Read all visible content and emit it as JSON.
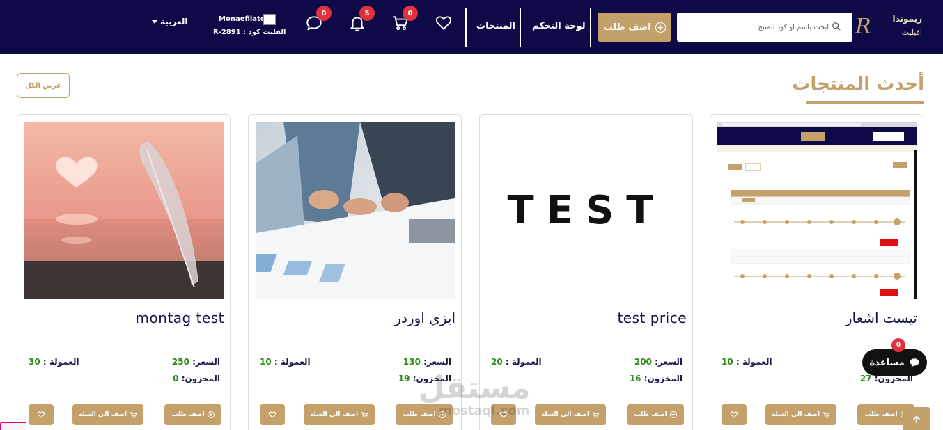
{
  "header": {
    "logo": {
      "line1": "ريموندا",
      "line2": "افيليت",
      "mark": "R"
    },
    "search": {
      "placeholder": "ابحث باسم او كود المنتج"
    },
    "add_order_label": "اضف طلب",
    "nav_links": {
      "dashboard": "لوحة التحكم",
      "products": "المنتجات"
    },
    "badges": {
      "cart": "0",
      "notifications": "5",
      "messages": "0"
    },
    "user": {
      "name": "Monaefilate",
      "code": "R-2891 : الفليت كود"
    },
    "language": "العربية"
  },
  "section": {
    "title": "أحدث المنتجات",
    "view_all_label": "عرض الكل"
  },
  "labels": {
    "price": "السعر:",
    "commission": "العمولة :",
    "stock": "المخزون:",
    "add_order": "اضف طلب",
    "add_to_cart": "اضف الي السلة"
  },
  "products": [
    {
      "name": "تيست اشعار",
      "price": "",
      "commission": "10",
      "stock": "27",
      "image": "screenshot"
    },
    {
      "name": "test price",
      "price": "200",
      "commission": "20",
      "stock": "16",
      "image": "test-text"
    },
    {
      "name": "ايزي اوردر",
      "price": "130",
      "commission": "10",
      "stock": "19",
      "image": "meeting-hands"
    },
    {
      "name": "montag test",
      "price": "250",
      "commission": "30",
      "stock": "0",
      "image": "feather-sunset"
    }
  ],
  "test_image_text": "TEST",
  "help": {
    "label": "مساعدة",
    "badge": "0"
  },
  "watermark": {
    "arabic": "مستقل",
    "latin": "mostaql.com"
  },
  "colors": {
    "navbar": "#0d0a47",
    "accent": "#c4a06a",
    "badge": "#e0323c",
    "value_green": "#2e8b1a"
  }
}
